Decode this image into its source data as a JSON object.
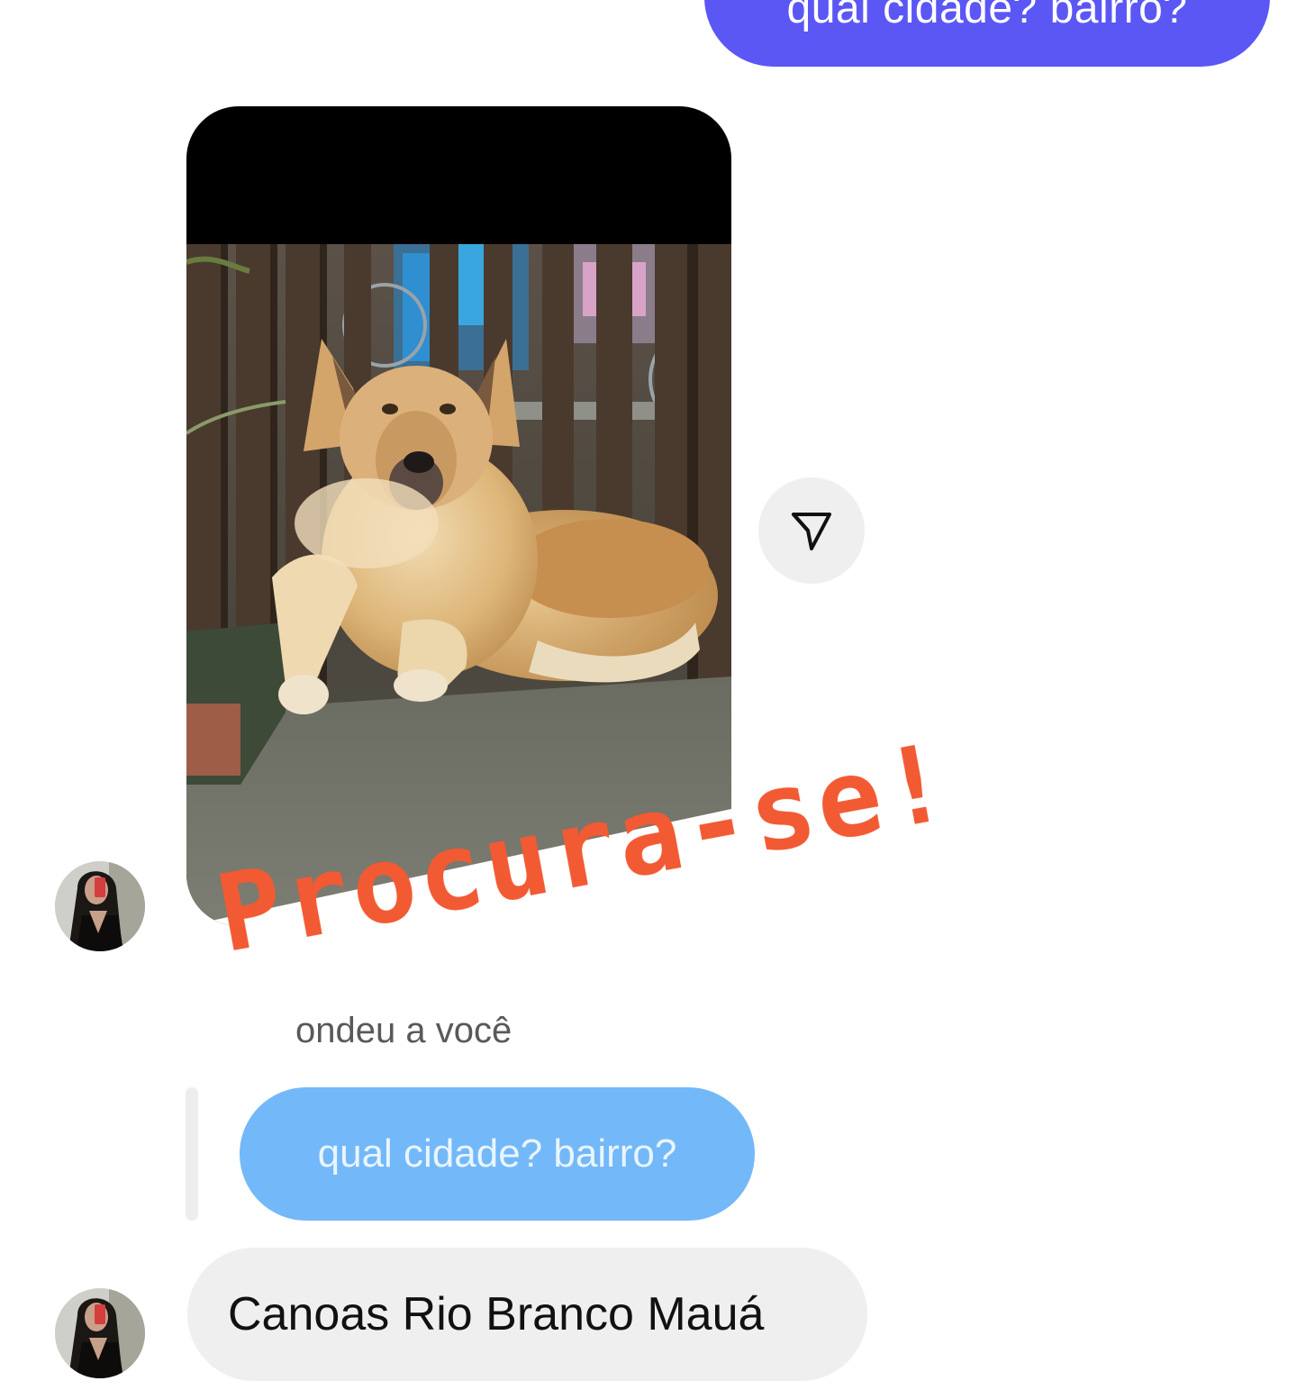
{
  "messages": {
    "sent_text": "qual cidade? bairro?",
    "story_sticker": "Procura-se!",
    "reply_label": "respondeu a você",
    "reply_label_visible": "ondeu a você",
    "quoted_text": "qual cidade? bairro?",
    "received_text": "Canoas Rio Branco Mauá"
  },
  "icons": {
    "share": "paper-plane-icon",
    "avatar": "avatar-photo"
  },
  "colors": {
    "sent_bubble": "#5b57f5",
    "quoted_bubble": "#73b8f9",
    "received_bubble": "#efefef",
    "sticker": "#f25a33"
  }
}
